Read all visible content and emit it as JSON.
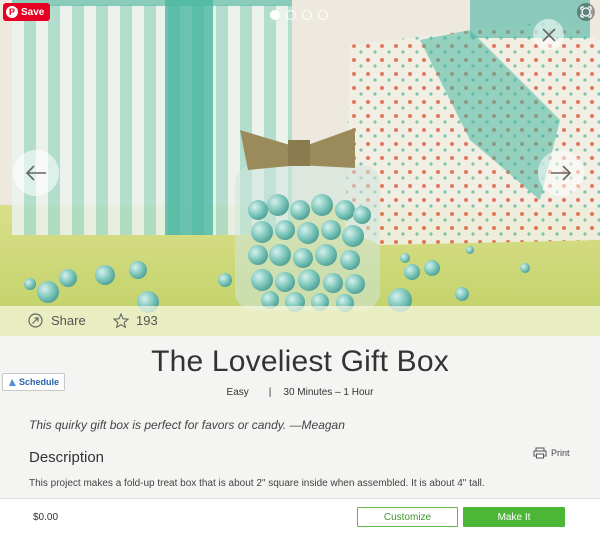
{
  "hero": {
    "save_label": "Save",
    "slide_count": 4,
    "active_slide": 1,
    "share_label": "Share",
    "favorite_count": "193"
  },
  "project": {
    "title": "The Loveliest Gift Box",
    "difficulty": "Easy",
    "meta_separator": "|",
    "duration": "30 Minutes – 1 Hour",
    "schedule_label": "Schedule",
    "quote": "This quirky gift box is perfect for favors or candy.  —Meagan",
    "description_title": "Description",
    "print_label": "Print",
    "description_text": "This project makes a fold-up treat box that is about 2\" square inside when assembled. It is about 4\" tall."
  },
  "footer": {
    "price": "$0.00",
    "customize_label": "Customize",
    "make_it_label": "Make It"
  },
  "colors": {
    "pin_red": "#e60023",
    "make_it_green": "#4cb636",
    "customize_border": "#62b94b",
    "schedule_blue": "#2a63a8"
  }
}
